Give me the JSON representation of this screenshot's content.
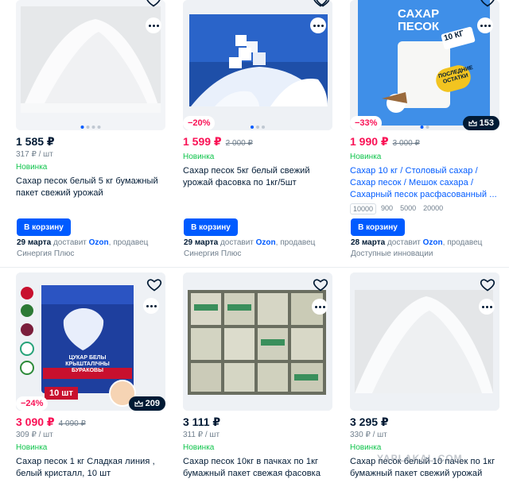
{
  "row1": [
    {
      "price": "1 585 ₽",
      "old_price": "",
      "unit_price": "317 ₽ / шт",
      "badge": "Новинка",
      "title": "Сахар песок белый 5 кг бумажный пакет свежий урожай",
      "cart_label": "В корзину",
      "delivery_date": "29 марта",
      "delivery_mid": " доставит ",
      "carrier": "Ozon",
      "seller_prefix": ", продавец",
      "seller": "Синергия Плюс"
    },
    {
      "discount": "−20%",
      "price": "1 599 ₽",
      "old_price": "2 000 ₽",
      "badge": "Новинка",
      "title": "Сахар песок 5кг белый свежий урожай фасовка по 1кг/5шт",
      "cart_label": "В корзину",
      "delivery_date": "29 марта",
      "delivery_mid": " доставит ",
      "carrier": "Ozon",
      "seller_prefix": ", продавец",
      "seller": "Синергия Плюс"
    },
    {
      "discount": "−33%",
      "rating_count": "153",
      "price": "1 990 ₽",
      "old_price": "3 000 ₽",
      "badge": "Новинка",
      "title": "Сахар 10 кг / Столовый сахар / Сахар песок / Мешок сахара / Сахарный песок расфасованный ...",
      "weights": [
        "10000",
        "900",
        "5000",
        "20000"
      ],
      "image_text_top": "САХАР",
      "image_text_bottom": "ПЕСОК",
      "image_weight": "10 КГ",
      "image_stamp": "ПОСЛЕДНИЕ ОСТАТКИ",
      "cart_label": "В корзину",
      "delivery_date": "28 марта",
      "delivery_mid": " доставит ",
      "carrier": "Ozon",
      "seller_prefix": ", продавец",
      "seller": "Доступные инновации"
    }
  ],
  "row2": [
    {
      "discount": "−24%",
      "rating_count": "209",
      "image_label": "10 шт",
      "image_pack_text": "ЦУКАР БЕЛЫ КРЫШТАЛІЧНЫ БУРАКОВЫ",
      "price": "3 090 ₽",
      "old_price": "4 090 ₽",
      "unit_price": "309 ₽ / шт",
      "badge": "Новинка",
      "title": "Сахар песок 1 кг Сладкая линия , белый кристалл, 10 шт"
    },
    {
      "price": "3 111 ₽",
      "old_price": "",
      "unit_price": "311 ₽ / шт",
      "badge": "Новинка",
      "title": "Сахар песок 10кг в пачках по 1кг бумажный пакет свежая фасовка"
    },
    {
      "price": "3 295 ₽",
      "old_price": "",
      "unit_price": "330 ₽ / шт",
      "badge": "Новинка",
      "title": "Сахар песок белый 10 пачек по 1кг бумажный пакет свежий урожай"
    }
  ],
  "watermark": "YAPLAKAL.COM",
  "colors": {
    "accent": "#005bff",
    "price_red": "#f91155",
    "new_green": "#10c44c",
    "text_primary": "#001a34",
    "text_secondary": "#707f8d"
  },
  "icons": [
    "heart-icon",
    "more-dots-icon",
    "crown-icon"
  ]
}
